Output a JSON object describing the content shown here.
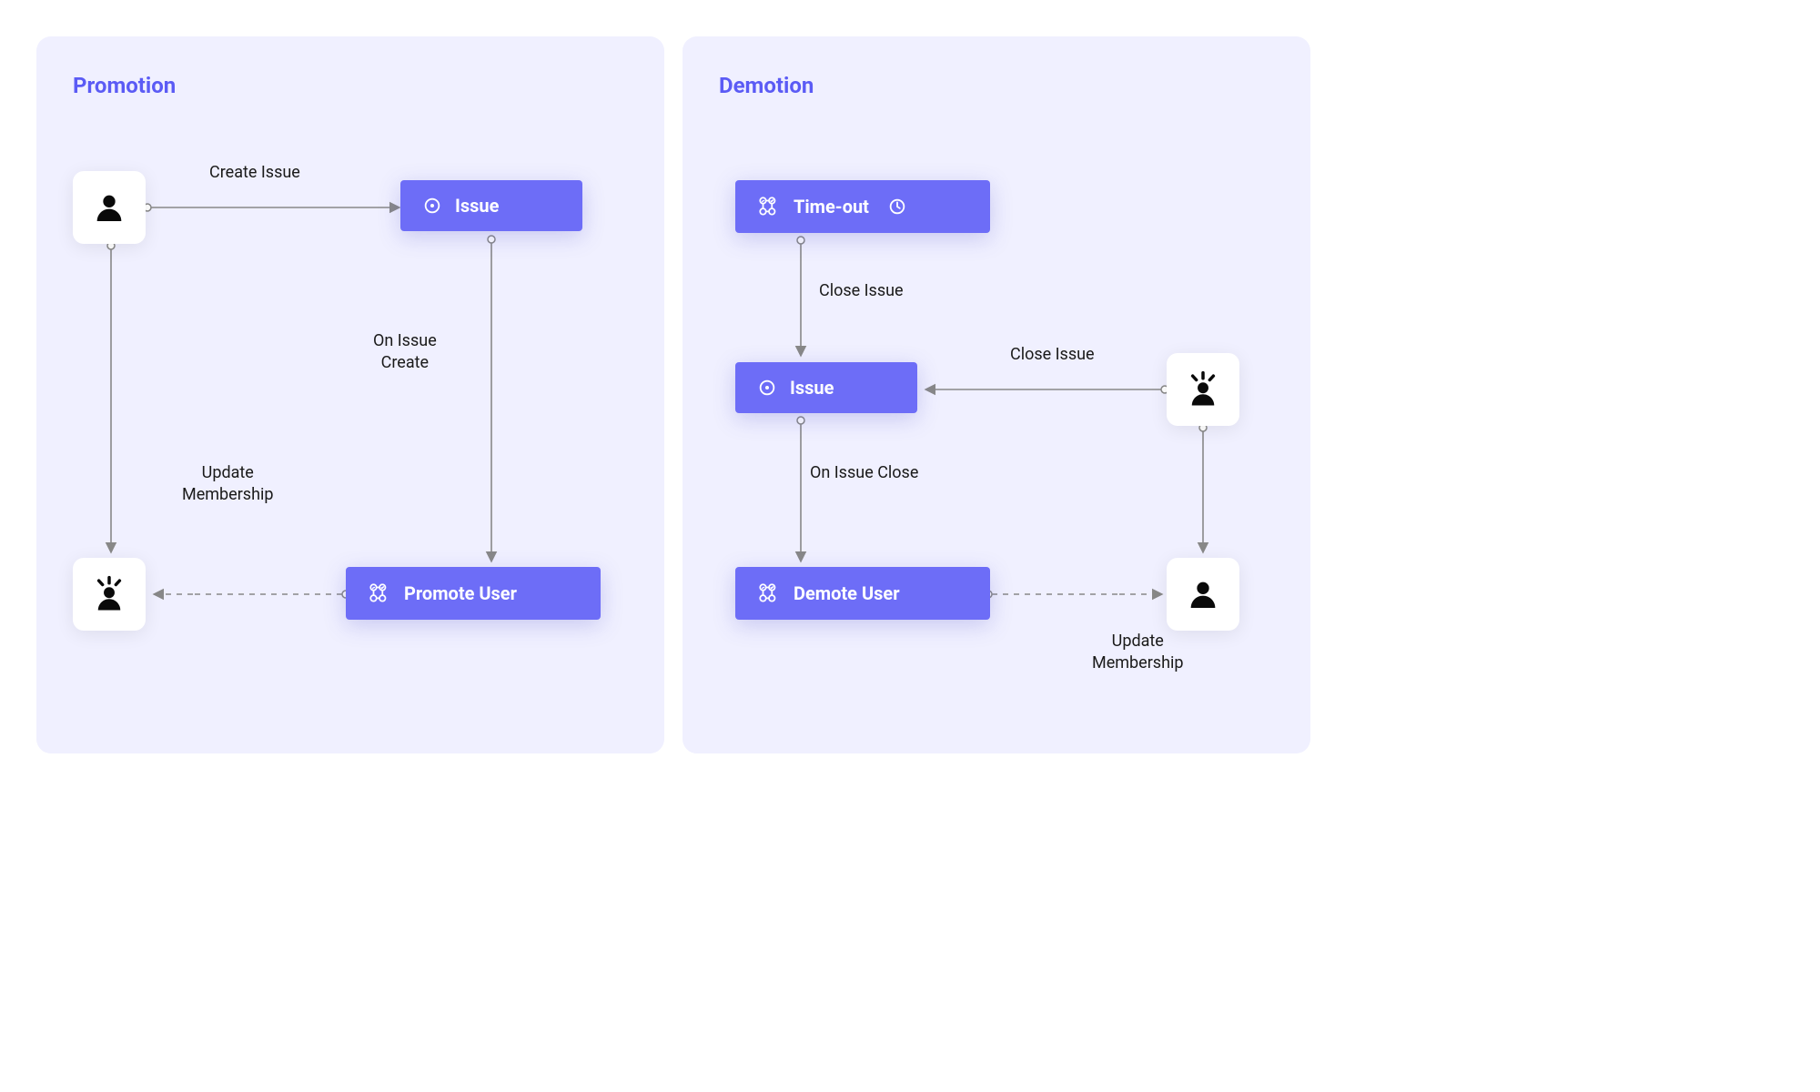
{
  "promotion": {
    "title": "Promotion",
    "labels": {
      "create_issue": "Create Issue",
      "on_issue_create": "On Issue\nCreate",
      "update_membership": "Update\nMembership",
      "issue": "Issue",
      "promote_user": "Promote User"
    }
  },
  "demotion": {
    "title": "Demotion",
    "labels": {
      "timeout": "Time-out",
      "close_issue": "Close Issue",
      "close_issue2": "Close Issue",
      "on_issue_close": "On Issue Close",
      "update_membership": "Update\nMembership",
      "issue": "Issue",
      "demote_user": "Demote User"
    }
  }
}
